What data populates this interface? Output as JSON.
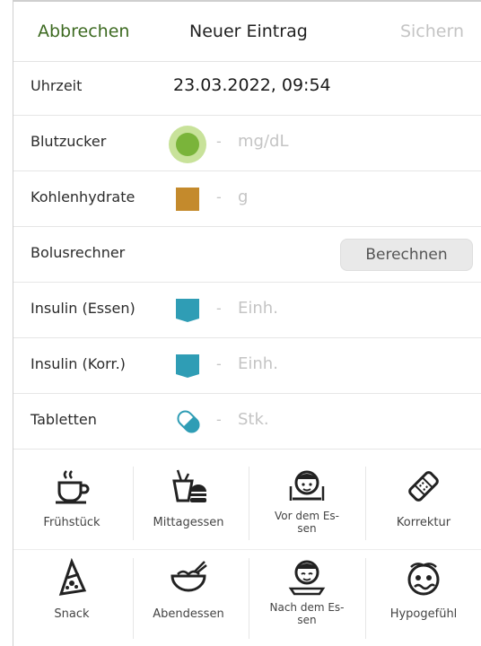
{
  "header": {
    "cancel": "Abbrechen",
    "title": "Neuer Eintrag",
    "save": "Sichern"
  },
  "rows": {
    "time": {
      "label": "Uhrzeit",
      "value": "23.03.2022, 09:54"
    },
    "bloodsugar": {
      "label": "Blutzucker",
      "dash": "-",
      "unit": "mg/dL"
    },
    "carbs": {
      "label": "Kohlenhydrate",
      "dash": "-",
      "unit": "g"
    },
    "bolus": {
      "label": "Bolusrechner",
      "button": "Berechnen"
    },
    "insulin_meal": {
      "label": "Insulin (Essen)",
      "dash": "-",
      "unit": "Einh."
    },
    "insulin_corr": {
      "label": "Insulin (Korr.)",
      "dash": "-",
      "unit": "Einh."
    },
    "pills": {
      "label": "Tabletten",
      "dash": "-",
      "unit": "Stk."
    }
  },
  "tags": [
    {
      "label": "Frühstück",
      "icon": "coffee-cup-icon"
    },
    {
      "label": "Mittagessen",
      "icon": "fast-food-icon"
    },
    {
      "label": "Vor dem Es-\nsen",
      "icon": "face-before-meal-icon"
    },
    {
      "label": "Korrektur",
      "icon": "bandage-icon"
    },
    {
      "label": "Snack",
      "icon": "pizza-slice-icon"
    },
    {
      "label": "Abendessen",
      "icon": "noodle-bowl-icon"
    },
    {
      "label": "Nach dem Es-\nsen",
      "icon": "face-after-meal-icon"
    },
    {
      "label": "Hypogefühl",
      "icon": "dizzy-face-icon"
    }
  ],
  "colors": {
    "cancel": "#3d6a21",
    "bloodsugar": "#7ab43a",
    "carbs": "#c48a2c",
    "insulin": "#2f9db5",
    "pill": "#2f9db5"
  }
}
